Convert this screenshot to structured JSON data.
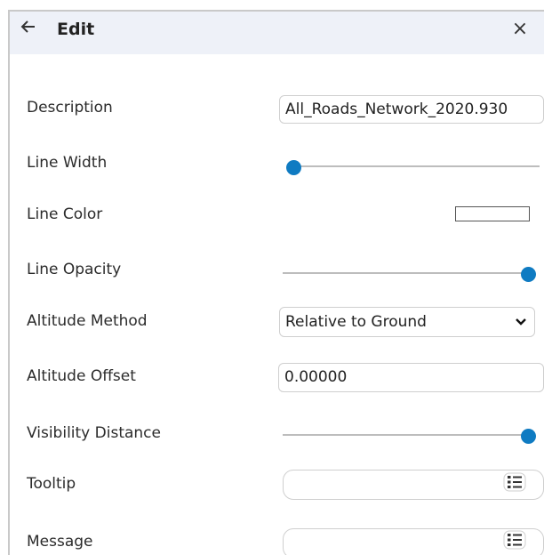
{
  "header": {
    "title": "Edit",
    "back_icon": "arrow-left-icon",
    "close_icon": "close-icon",
    "close_glyph": "×",
    "background": "#eef1f8"
  },
  "form": {
    "description": {
      "label": "Description",
      "value": "All_Roads_Network_2020.930"
    },
    "line_width": {
      "label": "Line Width",
      "value_fraction": 0.0
    },
    "line_color": {
      "label": "Line Color",
      "color": "#ffffff"
    },
    "line_opacity": {
      "label": "Line Opacity",
      "value_fraction": 1.0
    },
    "altitude_method": {
      "label": "Altitude Method",
      "selected": "Relative to Ground"
    },
    "altitude_offset": {
      "label": "Altitude Offset",
      "value": "0.00000"
    },
    "visibility_distance": {
      "label": "Visibility Distance",
      "value_fraction": 1.0
    },
    "tooltip": {
      "label": "Tooltip",
      "value": "",
      "icon": "list-icon"
    },
    "message": {
      "label": "Message",
      "value": "",
      "icon": "list-icon"
    }
  },
  "colors": {
    "accent": "#0f7bc2",
    "track": "#bdbdbd",
    "border": "#cfcfcf"
  }
}
